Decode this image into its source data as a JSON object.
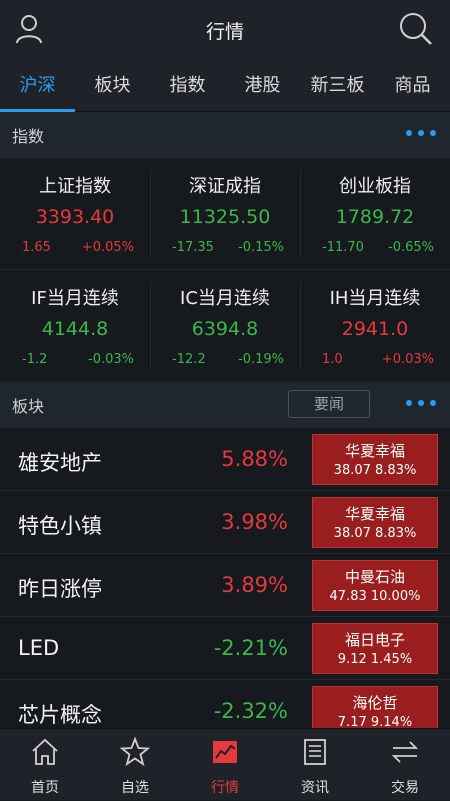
{
  "header": {
    "title": "行情"
  },
  "tabs": [
    "沪深",
    "板块",
    "指数",
    "港股",
    "新三板",
    "商品"
  ],
  "index_section": {
    "title": "指数"
  },
  "indices": [
    {
      "name": "上证指数",
      "value": "3393.40",
      "change": "1.65",
      "pct": "+0.05%",
      "dir": "up"
    },
    {
      "name": "深证成指",
      "value": "11325.50",
      "change": "-17.35",
      "pct": "-0.15%",
      "dir": "down"
    },
    {
      "name": "创业板指",
      "value": "1789.72",
      "change": "-11.70",
      "pct": "-0.65%",
      "dir": "down"
    },
    {
      "name": "IF当月连续",
      "value": "4144.8",
      "change": "-1.2",
      "pct": "-0.03%",
      "dir": "down"
    },
    {
      "name": "IC当月连续",
      "value": "6394.8",
      "change": "-12.2",
      "pct": "-0.19%",
      "dir": "down"
    },
    {
      "name": "IH当月连续",
      "value": "2941.0",
      "change": "1.0",
      "pct": "+0.03%",
      "dir": "up"
    }
  ],
  "sector_section": {
    "title": "板块",
    "news_label": "要闻"
  },
  "sectors": [
    {
      "name": "雄安地产",
      "pct": "5.88%",
      "dir": "up",
      "stock_name": "华夏幸福",
      "stock_info": "38.07 8.83%"
    },
    {
      "name": "特色小镇",
      "pct": "3.98%",
      "dir": "up",
      "stock_name": "华夏幸福",
      "stock_info": "38.07 8.83%"
    },
    {
      "name": "昨日涨停",
      "pct": "3.89%",
      "dir": "up",
      "stock_name": "中曼石油",
      "stock_info": "47.83 10.00%"
    },
    {
      "name": "LED",
      "pct": "-2.21%",
      "dir": "down",
      "stock_name": "福日电子",
      "stock_info": "9.12 1.45%"
    },
    {
      "name": "芯片概念",
      "pct": "-2.32%",
      "dir": "down",
      "stock_name": "海伦哲",
      "stock_info": "7.17 9.14%"
    }
  ],
  "bottom_nav": [
    {
      "label": "首页",
      "icon": "home-icon"
    },
    {
      "label": "自选",
      "icon": "star-icon"
    },
    {
      "label": "行情",
      "icon": "chart-icon",
      "active": true
    },
    {
      "label": "资讯",
      "icon": "news-icon"
    },
    {
      "label": "交易",
      "icon": "trade-icon"
    }
  ],
  "colors": {
    "accent": "#2a9cf0",
    "up": "#e5393c",
    "down": "#3cb64a",
    "stock_box": "#9b1e1e"
  }
}
